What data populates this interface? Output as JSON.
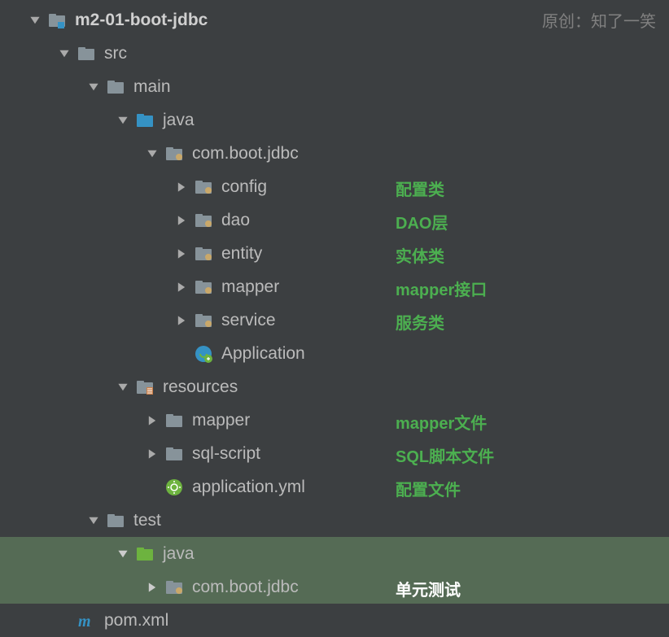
{
  "watermark": "原创：知了一笑",
  "tree": {
    "root": "m2-01-boot-jdbc",
    "src": "src",
    "main": "main",
    "java": "java",
    "package": "com.boot.jdbc",
    "config": "config",
    "dao": "dao",
    "entity": "entity",
    "mapper_pkg": "mapper",
    "service": "service",
    "application": "Application",
    "resources": "resources",
    "mapper_dir": "mapper",
    "sqlscript": "sql-script",
    "appyml": "application.yml",
    "test": "test",
    "test_java": "java",
    "test_pkg": "com.boot.jdbc",
    "pom": "pom.xml"
  },
  "annotations": {
    "config": "配置类",
    "dao": "DAO层",
    "entity": "实体类",
    "mapper_pkg": "mapper接口",
    "service": "服务类",
    "mapper_dir": "mapper文件",
    "sqlscript": "SQL脚本文件",
    "appyml": "配置文件",
    "test_pkg": "单元测试"
  }
}
